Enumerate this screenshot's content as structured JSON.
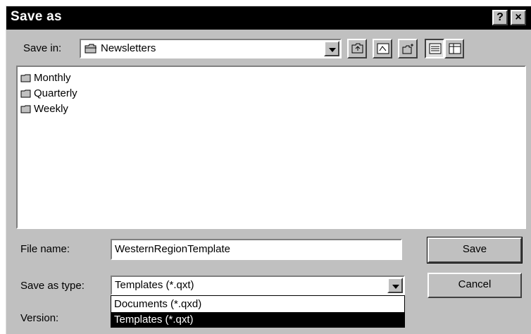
{
  "window": {
    "title": "Save as",
    "help_glyph": "?",
    "close_glyph": "×"
  },
  "save_in": {
    "label": "Save in:",
    "value": "Newsletters"
  },
  "toolbar": {
    "icons": [
      "up-one-level-icon",
      "desktop-icon",
      "new-folder-icon",
      "list-view-icon",
      "details-view-icon"
    ]
  },
  "file_list": {
    "items": [
      {
        "name": "Monthly"
      },
      {
        "name": "Quarterly"
      },
      {
        "name": "Weekly"
      }
    ]
  },
  "file_name": {
    "label": "File name:",
    "value": "WesternRegionTemplate"
  },
  "save_as_type": {
    "label": "Save as type:",
    "value": "Templates (*.qxt)",
    "options": [
      "Documents (*.qxd)",
      "Templates (*.qxt)"
    ],
    "selected_index": 1
  },
  "version": {
    "label": "Version:"
  },
  "buttons": {
    "save": "Save",
    "cancel": "Cancel"
  },
  "colors": {
    "titlebar": "#000000",
    "dialog_face": "#c0c0c0",
    "selection": "#000000"
  }
}
